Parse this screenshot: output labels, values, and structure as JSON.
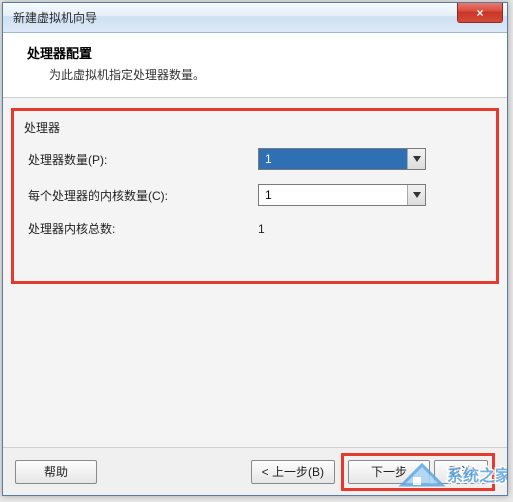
{
  "window": {
    "title": "新建虚拟机向导",
    "close_glyph": "×"
  },
  "header": {
    "title": "处理器配置",
    "subtitle": "为此虚拟机指定处理器数量。"
  },
  "section": {
    "group_label": "处理器",
    "rows": {
      "cpu_count_label": "处理器数量(P):",
      "cpu_count_value": "1",
      "cores_per_cpu_label": "每个处理器的内核数量(C):",
      "cores_per_cpu_value": "1",
      "total_cores_label": "处理器内核总数:",
      "total_cores_value": "1"
    }
  },
  "footer": {
    "help": "帮助",
    "back": "< 上一步(B)",
    "next": "下一步",
    "cancel": "取消"
  },
  "watermark": {
    "text": "系统之家"
  }
}
